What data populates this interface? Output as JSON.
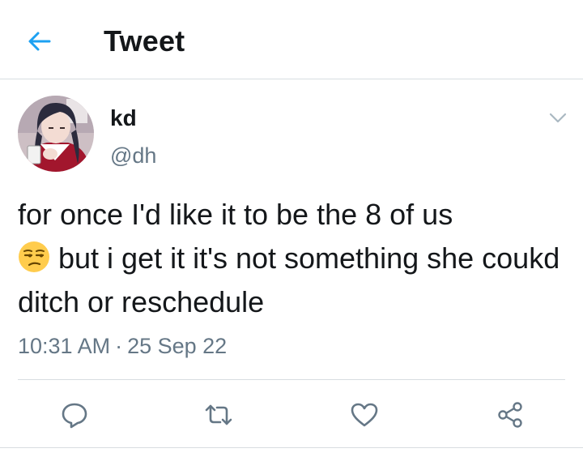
{
  "header": {
    "title": "Tweet",
    "back_icon": "arrow-left-icon"
  },
  "tweet": {
    "author": {
      "display_name": "kd",
      "handle": "@dh",
      "avatar": "avatar"
    },
    "text_line_1": "for once I'd like it to be the 8 of us",
    "emoji": "unamused-face",
    "text_rest": "but i get it it's not something she coukd ditch or reschedule",
    "time": "10:31 AM",
    "separator": "·",
    "date": "25 Sep 22"
  },
  "actions": [
    "reply-icon",
    "retweet-icon",
    "like-icon",
    "share-icon"
  ],
  "colors": {
    "accent": "#1da1f2",
    "text": "#14171a",
    "secondary": "#657786",
    "border": "#d8dde1"
  }
}
